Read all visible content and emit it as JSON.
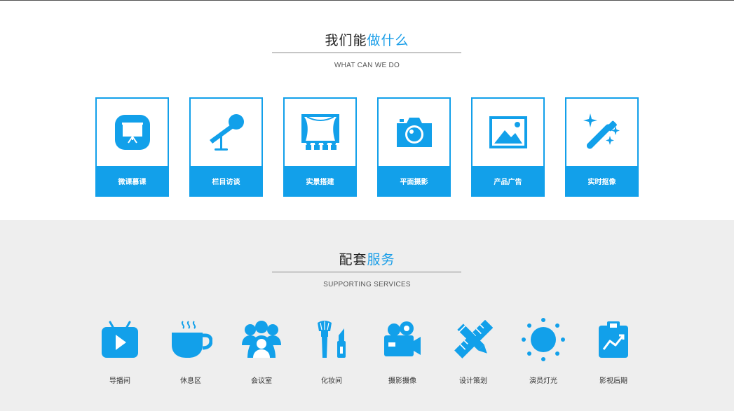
{
  "what_section": {
    "title_dark": "我们能",
    "title_accent": "做什么",
    "subtitle": "WHAT CAN WE DO",
    "cards": [
      {
        "label": "微课慕课",
        "icon": "presentation-board-icon"
      },
      {
        "label": "栏目访谈",
        "icon": "microphone-icon"
      },
      {
        "label": "实景搭建",
        "icon": "stage-icon"
      },
      {
        "label": "平面摄影",
        "icon": "camera-icon"
      },
      {
        "label": "产品广告",
        "icon": "image-icon"
      },
      {
        "label": "实时抠像",
        "icon": "magic-wand-icon"
      }
    ]
  },
  "support_section": {
    "title_dark": "配套",
    "title_accent": "服务",
    "subtitle": "SUPPORTING SERVICES",
    "services": [
      {
        "label": "导播间",
        "icon": "tv-play-icon"
      },
      {
        "label": "休息区",
        "icon": "coffee-cup-icon"
      },
      {
        "label": "会议室",
        "icon": "group-people-icon"
      },
      {
        "label": "化妆间",
        "icon": "makeup-brush-lipstick-icon"
      },
      {
        "label": "摄影摄像",
        "icon": "video-camera-icon"
      },
      {
        "label": "设计策划",
        "icon": "pencil-ruler-icon"
      },
      {
        "label": "演员灯光",
        "icon": "sun-light-icon"
      },
      {
        "label": "影视后期",
        "icon": "clipboard-chart-icon"
      }
    ]
  },
  "colors": {
    "accent": "#1a9ee8",
    "card_blue": "#12a0ea",
    "support_bg": "#eeeeee"
  }
}
